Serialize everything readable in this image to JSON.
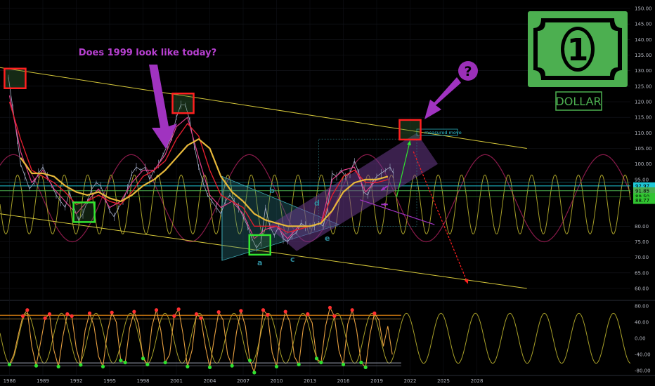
{
  "annotations": {
    "question_text": "Does 1999 look like today?",
    "question_mark": "?",
    "measured_move": "measured move",
    "wave_labels": [
      "a",
      "b",
      "c",
      "d",
      "e"
    ],
    "dollar_word": "DOLLAR",
    "dollar_digit": "1"
  },
  "colors": {
    "background": "#000000",
    "price": "#a9b1c9",
    "ma_fast": "#e0408a",
    "ma_mid": "#e01e2e",
    "ma_slow": "#e8b93a",
    "channel": "#d6c83a",
    "cycle_long": "#8a1a4a",
    "cycle_short": "#a8a028",
    "triangle": "#2e7d86",
    "projection": "#6a3a8a",
    "box_red": "#ff2020",
    "box_green": "#31e531",
    "arrow_purple": "#a033c0",
    "dollar_green": "#4caf50",
    "hline_cyan": "#1fc8d8",
    "hline_green": "#4caf50"
  },
  "chart_data": [
    {
      "type": "line",
      "title": "",
      "x_ticks": [
        "1986",
        "1989",
        "1992",
        "1995",
        "1998",
        "2001",
        "2004",
        "2007",
        "2010",
        "2013",
        "2016",
        "2019",
        "2022",
        "2025",
        "2028"
      ],
      "y_ticks": [
        "150.00",
        "145.00",
        "140.00",
        "135.00",
        "130.00",
        "125.00",
        "120.00",
        "115.00",
        "110.00",
        "105.00",
        "100.00",
        "95.00",
        "80.00",
        "75.00",
        "70.00",
        "65.00",
        "60.00"
      ],
      "ylim": [
        57,
        152
      ],
      "price_tags": [
        {
          "label": "92.97",
          "value": 92.97,
          "color": "#1fc8d8"
        },
        {
          "label": "91.85",
          "value": 91.4,
          "color": "#4caf50"
        },
        {
          "label": "89.50",
          "value": 89.5,
          "color": "#31c431"
        },
        {
          "label": "88.77",
          "value": 88.3,
          "color": "#31c431"
        }
      ],
      "series": [
        {
          "x": [
            1985.9,
            1986.3,
            1986.7,
            1987.0,
            1987.4,
            1987.8,
            1988.2,
            1988.6,
            1989.0,
            1989.4,
            1989.8,
            1990.2,
            1990.6,
            1991.0,
            1991.4,
            1991.8,
            1992.2,
            1992.6,
            1993.0,
            1993.4,
            1993.8,
            1994.2,
            1994.6,
            1995.0,
            1995.4,
            1995.8,
            1996.2,
            1996.6,
            1997.0,
            1997.4,
            1997.8,
            1998.2,
            1998.6,
            1999.0,
            1999.4,
            1999.8,
            2000.2,
            2000.6,
            2001.0,
            2001.4,
            2001.8,
            2002.2,
            2002.6,
            2003.0,
            2003.4,
            2003.8,
            2004.2,
            2004.6,
            2005.0,
            2005.4,
            2005.8,
            2006.2,
            2006.6,
            2007.0,
            2007.4,
            2007.8,
            2008.2,
            2008.6,
            2009.0,
            2009.4,
            2009.8,
            2010.2,
            2010.6,
            2011.0,
            2011.4,
            2011.8,
            2012.2,
            2012.6,
            2013.0,
            2013.4,
            2013.8,
            2014.2,
            2014.6,
            2015.0,
            2015.4,
            2015.8,
            2016.2,
            2016.6,
            2017.0,
            2017.4,
            2017.8,
            2018.2,
            2018.6,
            2019.0,
            2019.4,
            2019.8,
            2020.2,
            2020.5
          ],
          "values": [
            128,
            118,
            108,
            100,
            96,
            92,
            94,
            97,
            99,
            96,
            93,
            90,
            88,
            86,
            91,
            86,
            82,
            84,
            88,
            92,
            94,
            93,
            89,
            85,
            83,
            86,
            88,
            92,
            97,
            99,
            98,
            99,
            95,
            98,
            100,
            103,
            106,
            109,
            115,
            119,
            119,
            114,
            106,
            99,
            94,
            90,
            88,
            86,
            84,
            88,
            90,
            88,
            86,
            83,
            80,
            76,
            73,
            75,
            86,
            80,
            77,
            80,
            76,
            75,
            77,
            78,
            81,
            80,
            80,
            80,
            81,
            80,
            86,
            97,
            96,
            98,
            96,
            97,
            101,
            97,
            91,
            90,
            94,
            96,
            97,
            98,
            99,
            97
          ],
          "name": ""
        },
        {
          "x": [
            1986.0,
            1987.0,
            1988.0,
            1989.0,
            1990.0,
            1991.0,
            1992.0,
            1993.0,
            1994.0,
            1995.0,
            1996.0,
            1997.0,
            1998.0,
            1999.0,
            2000.0,
            2001.0,
            2002.0,
            2003.0,
            2004.0,
            2005.0,
            2006.0,
            2007.0,
            2008.0,
            2009.0,
            2010.0,
            2011.0,
            2012.0,
            2013.0,
            2014.0,
            2015.0,
            2016.0,
            2017.0,
            2018.0,
            2019.0,
            2020.0
          ],
          "values": [
            122,
            104,
            94,
            98,
            92,
            88,
            84,
            88,
            92,
            86,
            88,
            94,
            98,
            98,
            103,
            112,
            115,
            102,
            90,
            86,
            88,
            84,
            76,
            79,
            80,
            76,
            80,
            80,
            81,
            95,
            98,
            99,
            91,
            95,
            96
          ],
          "name": ""
        },
        {
          "x": [
            1986.0,
            1987.0,
            1988.0,
            1989.0,
            1990.0,
            1991.0,
            1992.0,
            1993.0,
            1994.0,
            1995.0,
            1996.0,
            1997.0,
            1998.0,
            1999.0,
            2000.0,
            2001.0,
            2002.0,
            2003.0,
            2004.0,
            2005.0,
            2006.0,
            2007.0,
            2008.0,
            2009.0,
            2010.0,
            2011.0,
            2012.0,
            2013.0,
            2014.0,
            2015.0,
            2016.0,
            2017.0,
            2018.0,
            2019.0,
            2020.0
          ],
          "values": [
            120,
            108,
            98,
            96,
            94,
            91,
            87,
            88,
            90,
            88,
            87,
            91,
            96,
            98,
            101,
            108,
            113,
            109,
            98,
            90,
            88,
            86,
            80,
            80,
            80,
            78,
            79,
            80,
            81,
            90,
            96,
            98,
            94,
            94,
            95
          ],
          "name": ""
        },
        {
          "x": [
            1987.0,
            1988.0,
            1989.0,
            1990.0,
            1991.0,
            1992.0,
            1993.0,
            1994.0,
            1995.0,
            1996.0,
            1997.0,
            1998.0,
            1999.0,
            2000.0,
            2001.0,
            2002.0,
            2003.0,
            2004.0,
            2005.0,
            2006.0,
            2007.0,
            2008.0,
            2009.0,
            2010.0,
            2011.0,
            2012.0,
            2013.0,
            2014.0,
            2015.0,
            2016.0,
            2017.0,
            2018.0,
            2019.0,
            2020.0
          ],
          "values": [
            102,
            97,
            97,
            96,
            93,
            91,
            90,
            91,
            89,
            88,
            90,
            93,
            95,
            98,
            102,
            106,
            108,
            105,
            96,
            91,
            88,
            84,
            82,
            81,
            80,
            80,
            80,
            81,
            85,
            91,
            94,
            95,
            95,
            96
          ],
          "name": ""
        }
      ]
    },
    {
      "type": "line",
      "title": "",
      "y_ticks": [
        "80.00",
        "40.00",
        "0.00",
        "-40.00",
        "-80.00"
      ],
      "ylim": [
        -92,
        92
      ],
      "series": [
        {
          "x": [
            1986.0,
            1986.4,
            1986.8,
            1987.2,
            1987.6,
            1988.0,
            1988.4,
            1988.8,
            1989.2,
            1989.6,
            1990.0,
            1990.4,
            1990.8,
            1991.2,
            1991.6,
            1992.0,
            1992.4,
            1992.8,
            1993.2,
            1993.6,
            1994.0,
            1994.4,
            1994.8,
            1995.2,
            1995.6,
            1996.0,
            1996.4,
            1996.8,
            1997.2,
            1997.6,
            1998.0,
            1998.4,
            1998.8,
            1999.2,
            1999.6,
            2000.0,
            2000.4,
            2000.8,
            2001.2,
            2001.6,
            2002.0,
            2002.4,
            2002.8,
            2003.2,
            2003.6,
            2004.0,
            2004.4,
            2004.8,
            2005.2,
            2005.6,
            2006.0,
            2006.4,
            2006.8,
            2007.2,
            2007.6,
            2008.0,
            2008.4,
            2008.8,
            2009.2,
            2009.6,
            2010.0,
            2010.4,
            2010.8,
            2011.2,
            2011.6,
            2012.0,
            2012.4,
            2012.8,
            2013.2,
            2013.6,
            2014.0,
            2014.4,
            2014.8,
            2015.2,
            2015.6,
            2016.0,
            2016.4,
            2016.8,
            2017.2,
            2017.6,
            2018.0,
            2018.4,
            2018.8,
            2019.2,
            2019.6,
            2020.0,
            2020.4
          ],
          "values": [
            -65,
            -40,
            10,
            55,
            70,
            -20,
            -68,
            -10,
            50,
            60,
            -30,
            -70,
            5,
            60,
            55,
            -25,
            -66,
            20,
            62,
            30,
            -45,
            -70,
            15,
            64,
            40,
            -55,
            -60,
            25,
            66,
            35,
            -50,
            -65,
            30,
            70,
            20,
            -60,
            -40,
            55,
            72,
            10,
            -70,
            -30,
            60,
            50,
            -20,
            -72,
            0,
            65,
            45,
            -40,
            -68,
            15,
            68,
            30,
            -55,
            -85,
            -20,
            70,
            58,
            -35,
            -70,
            20,
            66,
            40,
            -45,
            -65,
            25,
            60,
            38,
            -50,
            -60,
            30,
            76,
            55,
            -30,
            -65,
            35,
            70,
            20,
            -60,
            -72,
            10,
            62,
            45,
            -20,
            30,
            -40
          ],
          "name": ""
        }
      ]
    }
  ]
}
